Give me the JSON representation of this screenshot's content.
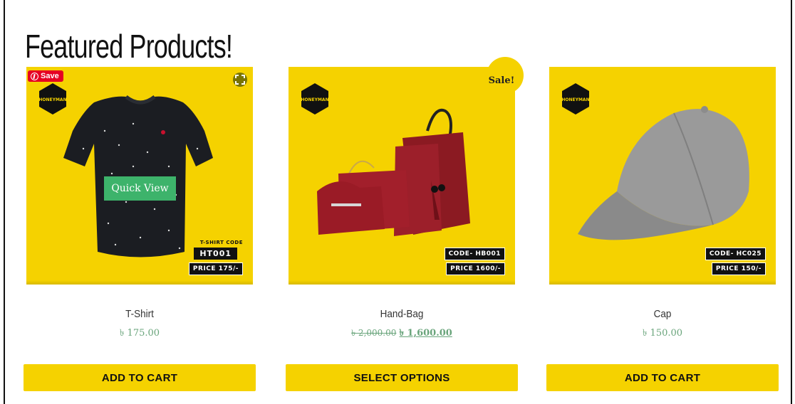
{
  "section": {
    "title": "Featured Products!"
  },
  "colors": {
    "accent": "#f5d200",
    "price": "#6aa57c",
    "quick_view": "#3db36b",
    "pinterest": "#e60023"
  },
  "products": [
    {
      "name": "T-Shirt",
      "price": "৳ 175.00",
      "button": "ADD TO CART",
      "image_tag_label": "T-SHIRT CODE",
      "image_code": "HT001",
      "image_price": "PRICE 175/-",
      "overlay_button": "Quick View",
      "pin_label": "Save"
    },
    {
      "name": "Hand-Bag",
      "old_price": "৳ 2,000.00",
      "price": "৳ 1,600.00",
      "button": "SELECT OPTIONS",
      "badge": "Sale!",
      "image_code": "CODE- HB001",
      "image_price": "PRICE 1600/-"
    },
    {
      "name": "Cap",
      "price": "৳ 150.00",
      "button": "ADD TO CART",
      "image_code": "CODE- HC025",
      "image_price": "PRICE 150/-"
    }
  ],
  "logo_text": "HONEYMAN"
}
